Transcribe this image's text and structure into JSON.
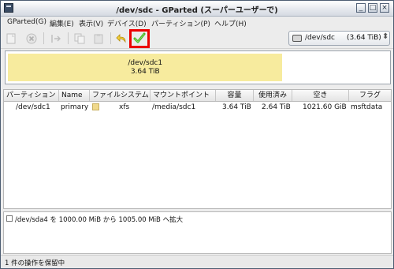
{
  "window": {
    "title": "/dev/sdc - GParted (スーパーユーザーで)",
    "minimize": "_",
    "maximize": "□",
    "close": "×"
  },
  "menu": [
    "GParted(G)",
    "編集(E)",
    "表示(V)",
    "デバイス(D)",
    "パーティション(P)",
    "ヘルプ(H)"
  ],
  "toolbar": {
    "new_icon": "new-partition-icon",
    "delete_icon": "delete-icon",
    "resize_icon": "resize-icon",
    "copy_icon": "copy-icon",
    "paste_icon": "paste-icon",
    "undo_icon": "undo-icon",
    "apply_icon": "apply-checkmark-icon",
    "apply_color": "#3fae1c",
    "highlight_color": "#ec0000"
  },
  "device_selector": {
    "device": "/dev/sdc",
    "size": "(3.64 TiB)"
  },
  "disk_map": {
    "label": "/dev/sdc1",
    "size": "3.64 TiB",
    "used_fraction": 0.72,
    "partition_color": "#f7eb9e"
  },
  "table": {
    "headers": [
      "パーティション",
      "Name",
      "ファイルシステム",
      "マウントポイント",
      "容量",
      "使用済み",
      "空き",
      "フラグ"
    ],
    "rows": [
      {
        "partition": "/dev/sdc1",
        "name": "primary",
        "filesystem": "xfs",
        "fs_color": "#f0d98c",
        "mountpoint": "/media/sdc1",
        "size": "3.64 TiB",
        "used": "2.64 TiB",
        "free": "1021.60 GiB",
        "flags": "msftdata"
      }
    ]
  },
  "operations": [
    "/dev/sda4 を 1000.00 MiB から 1005.00 MiB へ拡大"
  ],
  "status": "1 件の操作を保留中"
}
